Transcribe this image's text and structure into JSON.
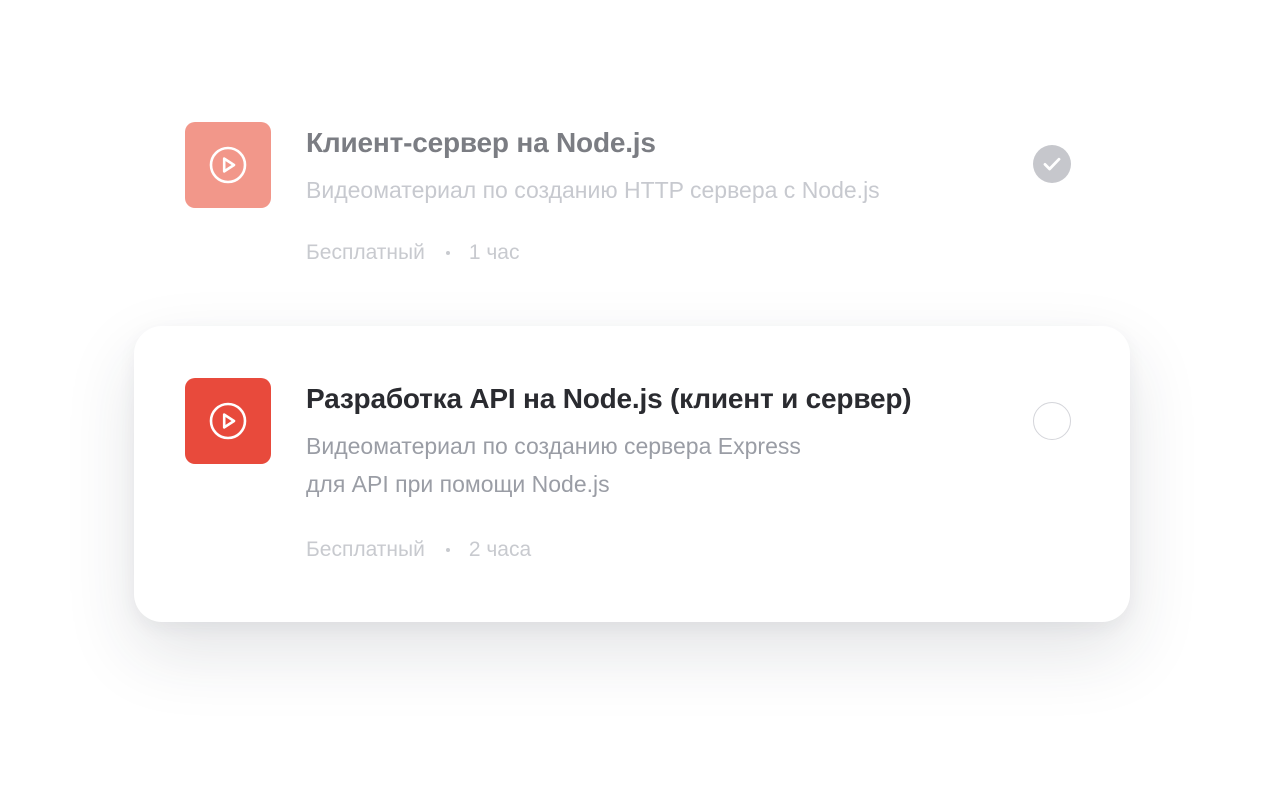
{
  "lessons": [
    {
      "title": "Клиент-сервер на Node.js",
      "description_lines": [
        "Видеоматериал по созданию HTTP сервера с Node.js"
      ],
      "price": "Бесплатный",
      "duration": "1 час",
      "completed": true,
      "icon": "play-circle-icon",
      "thumb_color": "#f2978a"
    },
    {
      "title": "Разработка API на Node.js (клиент и сервер)",
      "description_lines": [
        "Видеоматериал по созданию сервера Express",
        "для API при помощи Node.js"
      ],
      "price": "Бесплатный",
      "duration": "2 часа",
      "completed": false,
      "icon": "play-circle-icon",
      "thumb_color": "#e84a3c"
    }
  ]
}
